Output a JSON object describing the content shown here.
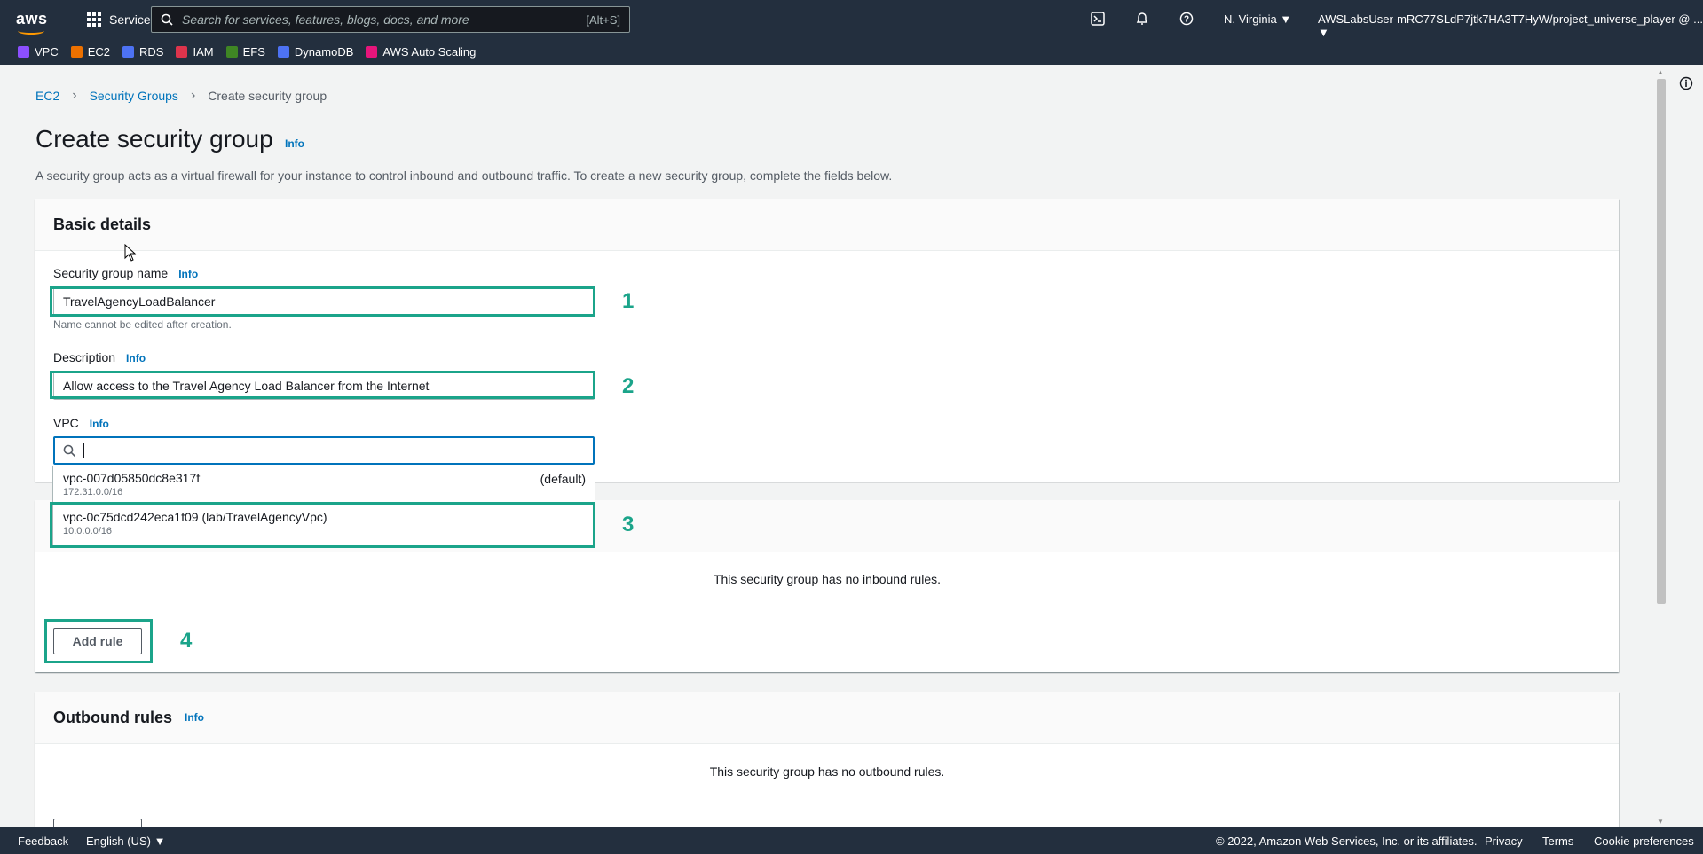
{
  "topnav": {
    "services_label": "Services",
    "search_placeholder": "Search for services, features, blogs, docs, and more",
    "search_shortcut": "[Alt+S]",
    "region": "N. Virginia",
    "account": "AWSLabsUser-mRC77SLdP7jtk7HA3T7HyW/project_universe_player @ ...",
    "logo": "aws"
  },
  "favorites": [
    {
      "label": "VPC",
      "color": "#8c4fff",
      "icon": "vpc-icon"
    },
    {
      "label": "EC2",
      "color": "#ed7100",
      "icon": "ec2-icon"
    },
    {
      "label": "RDS",
      "color": "#4d72f3",
      "icon": "rds-icon"
    },
    {
      "label": "IAM",
      "color": "#dd344c",
      "icon": "iam-icon"
    },
    {
      "label": "EFS",
      "color": "#3f8624",
      "icon": "efs-icon"
    },
    {
      "label": "DynamoDB",
      "color": "#4d72f3",
      "icon": "dynamodb-icon"
    },
    {
      "label": "AWS Auto Scaling",
      "color": "#e7157b",
      "icon": "autoscaling-icon"
    }
  ],
  "breadcrumb": {
    "ec2": "EC2",
    "sg": "Security Groups",
    "current": "Create security group"
  },
  "page": {
    "title": "Create security group",
    "info": "Info",
    "description": "A security group acts as a virtual firewall for your instance to control inbound and outbound traffic. To create a new security group, complete the fields below."
  },
  "basic": {
    "heading": "Basic details",
    "name_label": "Security group name",
    "name_value": "TravelAgencyLoadBalancer",
    "name_hint": "Name cannot be edited after creation.",
    "desc_label": "Description",
    "desc_value": "Allow access to the Travel Agency Load Balancer from the Internet",
    "vpc_label": "VPC",
    "info": "Info"
  },
  "vpc_options": [
    {
      "id": "vpc-007d05850dc8e317f",
      "cidr": "172.31.0.0/16",
      "tag": "(default)"
    },
    {
      "id": "vpc-0c75dcd242eca1f09 (lab/TravelAgencyVpc)",
      "cidr": "10.0.0.0/16",
      "tag": ""
    }
  ],
  "inbound": {
    "empty": "This security group has no inbound rules.",
    "add_rule": "Add rule"
  },
  "outbound": {
    "heading": "Outbound rules",
    "info": "Info",
    "empty": "This security group has no outbound rules."
  },
  "steps": [
    "1",
    "2",
    "3",
    "4"
  ],
  "footer": {
    "feedback": "Feedback",
    "language": "English (US)",
    "copyright": "© 2022, Amazon Web Services, Inc. or its affiliates.",
    "privacy": "Privacy",
    "terms": "Terms",
    "cookies": "Cookie preferences"
  },
  "colors": {
    "highlight": "#1ba48a",
    "nav": "#232f3e",
    "link": "#0073bb"
  }
}
